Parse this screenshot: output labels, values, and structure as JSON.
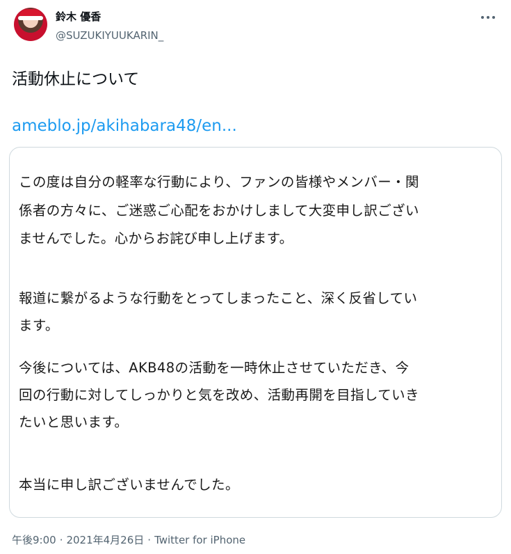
{
  "author": {
    "display_name": "鈴木 優香",
    "handle": "@SUZUKIYUUKARIN_"
  },
  "icons": {
    "avatar": "profile-photo",
    "more": "more-horizontal-icon"
  },
  "tweet": {
    "text": "活動休止について",
    "link": "ameblo.jp/akihabara48/en..."
  },
  "card": {
    "lines": [
      "この度は自分の軽率な行動により、ファンの皆様やメンバー・関",
      "係者の方々に、ご迷惑ご心配をおかけしまして大変申し訳ござい",
      "ませんでした。心からお詫び申し上げます。",
      "報道に繋がるような行動をとってしまったこと、深く反省してい",
      "ます。",
      "今後については、AKB48の活動を一時休止させていただき、今",
      "回の行動に対してしっかりと気を改め、活動再開を目指していき",
      "たいと思います。",
      "本当に申し訳ございませんでした。"
    ]
  },
  "meta": {
    "time": "午後9:00",
    "date": "2021年4月26日",
    "source": "Twitter for iPhone",
    "separator": "·"
  },
  "colors": {
    "text": "#0f1419",
    "secondary": "#536471",
    "link": "#1d9bf0",
    "border": "#cfd9de"
  }
}
